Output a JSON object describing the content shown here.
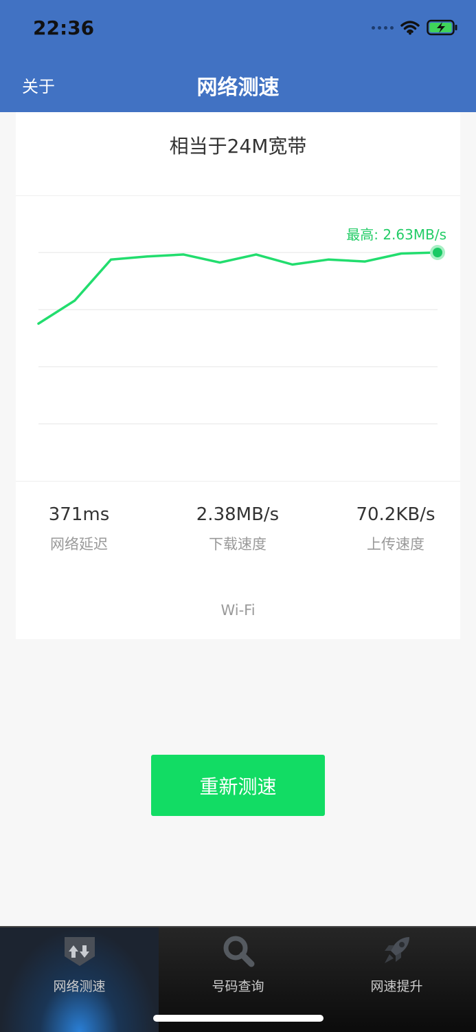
{
  "status_bar": {
    "time": "22:36"
  },
  "nav": {
    "back_label": "关于",
    "title": "网络测速"
  },
  "summary": {
    "equivalent_text": "相当于24M宽带"
  },
  "chart_data": {
    "type": "line",
    "peak_label": "最高: 2.63MB/s",
    "values": [
      1.0,
      1.23,
      1.64,
      1.67,
      1.69,
      1.61,
      1.69,
      1.59,
      1.64,
      1.62,
      1.7,
      1.71
    ],
    "series_color": "#22dd6e",
    "grid": true
  },
  "stats": [
    {
      "value": "371ms",
      "label": "网络延迟"
    },
    {
      "value": "2.38MB/s",
      "label": "下载速度"
    },
    {
      "value": "70.2KB/s",
      "label": "上传速度"
    }
  ],
  "network_type": "Wi-Fi",
  "retest_button": {
    "label": "重新测速"
  },
  "tabs": [
    {
      "label": "网络测速",
      "icon": "speed-test-icon",
      "active": true
    },
    {
      "label": "号码查询",
      "icon": "magnifier-icon",
      "active": false
    },
    {
      "label": "网速提升",
      "icon": "rocket-icon",
      "active": false
    }
  ],
  "colors": {
    "header": "#4172c3",
    "accent": "#12dc64",
    "line": "#22dd6e"
  }
}
